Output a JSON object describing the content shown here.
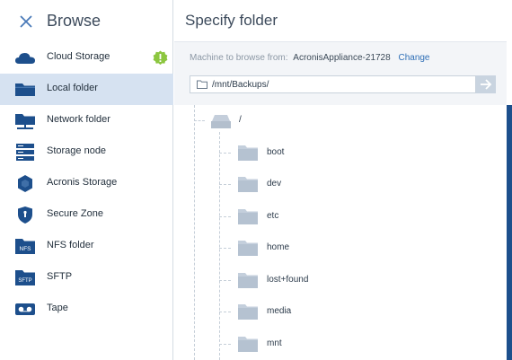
{
  "sidebar": {
    "title": "Browse",
    "close_icon": "close-icon",
    "items": [
      {
        "label": "Cloud Storage",
        "icon": "cloud-icon",
        "badge": "warning-badge-icon"
      },
      {
        "label": "Local folder",
        "icon": "local-folder-icon",
        "active": true
      },
      {
        "label": "Network folder",
        "icon": "network-folder-icon"
      },
      {
        "label": "Storage node",
        "icon": "storage-node-icon"
      },
      {
        "label": "Acronis Storage",
        "icon": "acronis-storage-icon"
      },
      {
        "label": "Secure Zone",
        "icon": "secure-zone-icon"
      },
      {
        "label": "NFS folder",
        "icon": "nfs-folder-icon",
        "icon_text": "NFS"
      },
      {
        "label": "SFTP",
        "icon": "sftp-icon",
        "icon_text": "SFTP"
      },
      {
        "label": "Tape",
        "icon": "tape-icon"
      }
    ]
  },
  "main": {
    "title": "Specify folder",
    "machine_caption": "Machine to browse from:",
    "machine_name": "AcronisAppliance-21728",
    "change_label": "Change",
    "path_value": "/mnt/Backups/",
    "go_icon": "arrow-right-icon",
    "tree": {
      "root": "/",
      "folders": [
        "boot",
        "dev",
        "etc",
        "home",
        "lost+found",
        "media",
        "mnt"
      ]
    }
  },
  "colors": {
    "accent_blue": "#1d4f8c",
    "active_row": "#d6e2f1",
    "badge_green": "#8cc63f",
    "link": "#2f6fb6"
  }
}
